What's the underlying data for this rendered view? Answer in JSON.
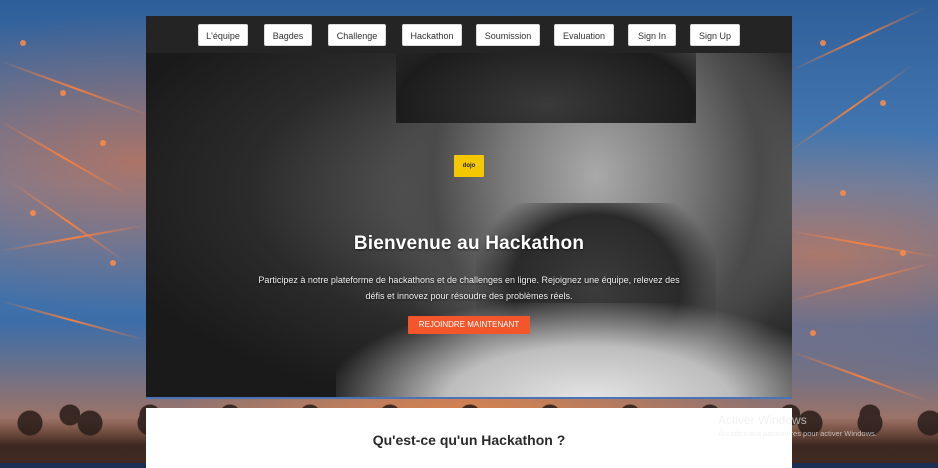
{
  "navbar": {
    "items": [
      {
        "label": "L'équipe"
      },
      {
        "label": "Bagdes"
      },
      {
        "label": "Challenge"
      },
      {
        "label": "Hackathon"
      },
      {
        "label": "Soumission"
      },
      {
        "label": "Evaluation"
      },
      {
        "label": "Sign In"
      },
      {
        "label": "Sign Up"
      }
    ]
  },
  "hero": {
    "logo_text": "dojo",
    "title": "Bienvenue au Hackathon",
    "description": "Participez à notre plateforme de hackathons et de challenges en ligne. Rejoignez une équipe, relevez des défis et innovez pour résoudre des problèmes réels.",
    "cta_label": "REJOINDRE MAINTENANT"
  },
  "section": {
    "title": "Qu'est-ce qu'un Hackathon ?"
  },
  "watermark": {
    "line1": "Activer Windows",
    "line2": "Accédez aux paramètres pour activer Windows."
  },
  "colors": {
    "accent": "#f2562a",
    "logo": "#f3c800",
    "navbar_bg": "#242424"
  }
}
